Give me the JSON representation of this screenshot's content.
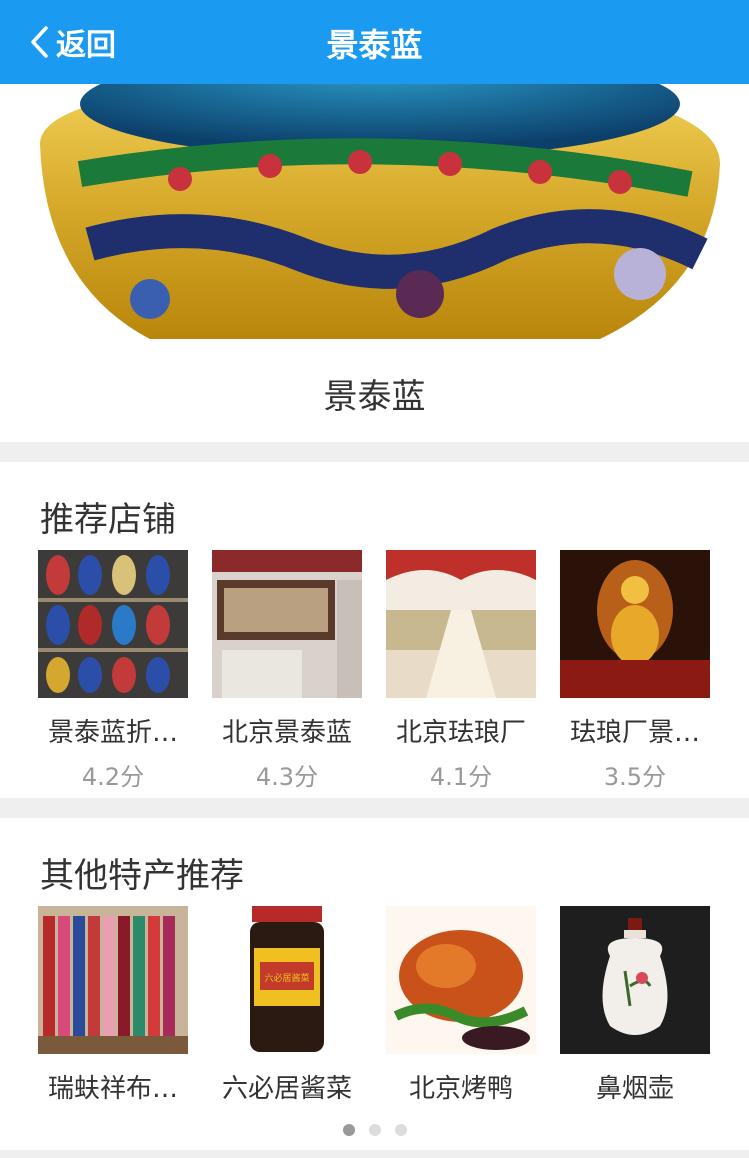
{
  "header": {
    "back_label": "返回",
    "title": "景泰蓝"
  },
  "hero": {
    "name": "景泰蓝"
  },
  "stores": {
    "title": "推荐店铺",
    "items": [
      {
        "name": "景泰蓝折…",
        "score": "4.2分"
      },
      {
        "name": "北京景泰蓝",
        "score": "4.3分"
      },
      {
        "name": "北京珐琅厂",
        "score": "4.1分"
      },
      {
        "name": "珐琅厂景…",
        "score": "3.5分"
      }
    ]
  },
  "specialties": {
    "title": "其他特产推荐",
    "items": [
      {
        "name": "瑞蚨祥布…"
      },
      {
        "name": "六必居酱菜"
      },
      {
        "name": "北京烤鸭"
      },
      {
        "name": "鼻烟壶"
      }
    ]
  },
  "jar_label": "六必居酱菜",
  "pagination": {
    "pages": 3,
    "active": 1
  }
}
